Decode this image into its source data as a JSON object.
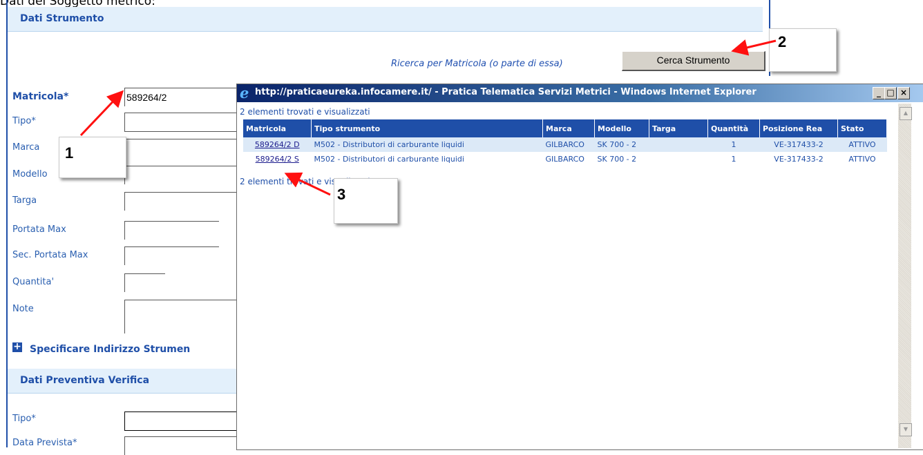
{
  "page": {
    "cut_heading": "Dati del Soggetto metrico:",
    "dati_strumento_title": "Dati Strumento",
    "search_hint": "Ricerca per Matricola (o parte di essa)",
    "cerca_button": "Cerca Strumento",
    "specify_address": "Specificare Indirizzo Strumen",
    "dati_preventiva_title": "Dati Preventiva Verifica"
  },
  "form_strumento": {
    "matricola_label": "Matricola*",
    "matricola_value": "589264/2",
    "tipo_label": "Tipo*",
    "marca_label": "Marca",
    "modello_label": "Modello",
    "targa_label": "Targa",
    "portata_label": "Portata Max",
    "sec_portata_label": "Sec. Portata Max",
    "quantita_label": "Quantita'",
    "note_label": "Note"
  },
  "form_preventiva": {
    "tipo_label": "Tipo*",
    "data_label": "Data Prevista*"
  },
  "callouts": {
    "c1": "1",
    "c2": "2",
    "c3": "3"
  },
  "ie_window": {
    "title": "http://praticaeureka.infocamere.it/ - Pratica Telematica Servizi Metrici - Windows Internet Explorer",
    "result_count_top": "2 elementi trovati e visualizzati",
    "result_count_bottom": "2 elementi trovati e visualizzati",
    "columns": [
      "Matricola",
      "Tipo strumento",
      "Marca",
      "Modello",
      "Targa",
      "Quantità",
      "Posizione Rea",
      "Stato"
    ],
    "rows": [
      {
        "matricola": "589264/2 D",
        "tipo": "M502 - Distributori di carburante liquidi",
        "marca": "GILBARCO",
        "modello": "SK 700 - 2",
        "targa": "",
        "quantita": "1",
        "rea": "VE-317433-2",
        "stato": "ATTIVO"
      },
      {
        "matricola": "589264/2 S",
        "tipo": "M502 - Distributori di carburante liquidi",
        "marca": "GILBARCO",
        "modello": "SK 700 - 2",
        "targa": "",
        "quantita": "1",
        "rea": "VE-317433-2",
        "stato": "ATTIVO"
      }
    ]
  },
  "colors": {
    "accent": "#1f4fa8",
    "section_bg": "#e3f0fb",
    "arrow": "#ff1010",
    "ie_title_bg": "#0a246a"
  }
}
